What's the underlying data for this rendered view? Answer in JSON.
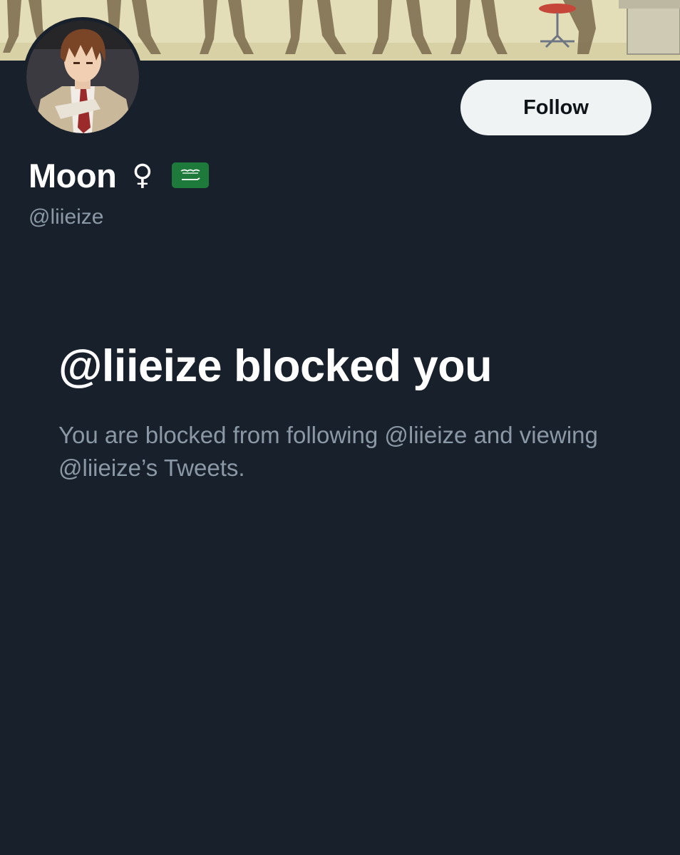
{
  "profile": {
    "display_name": "Moon",
    "gender_symbol": "♀",
    "flag_icon": "saudi-arabia-flag-icon",
    "handle": "@liieize"
  },
  "actions": {
    "follow_label": "Follow"
  },
  "blocked": {
    "title": "@liieize blocked you",
    "description": "You are blocked from following @liieize and viewing @liieize’s Tweets."
  },
  "colors": {
    "background": "#18202b",
    "primary_text": "#ffffff",
    "secondary_text": "#8b98a5",
    "follow_button_bg": "#eff3f4",
    "follow_button_text": "#0f1419",
    "flag_green": "#1d7a3a"
  }
}
